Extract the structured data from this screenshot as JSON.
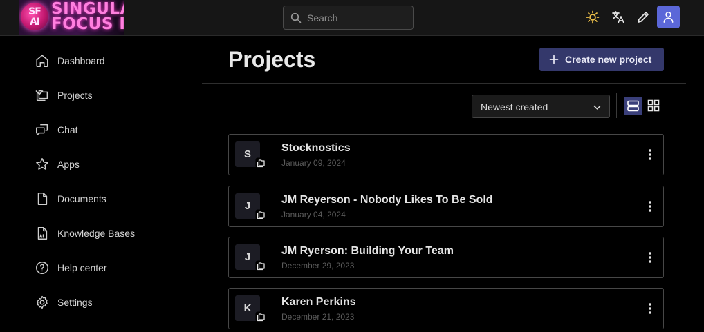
{
  "logo": {
    "badge_line1": "SF",
    "badge_line2": "AI",
    "text_line1": "SINGULAR",
    "text_line2": "FOCUS  I"
  },
  "search": {
    "placeholder": "Search"
  },
  "topbar": {
    "icons": [
      "sun-icon",
      "translate-icon",
      "pencil-icon",
      "user-icon"
    ],
    "accent": "#5b67d8"
  },
  "sidebar": {
    "items": [
      {
        "label": "Dashboard",
        "icon": "home-icon"
      },
      {
        "label": "Projects",
        "icon": "folders-icon",
        "expandable": true
      },
      {
        "label": "Chat",
        "icon": "chat-icon"
      },
      {
        "label": "Apps",
        "icon": "star-icon"
      },
      {
        "label": "Documents",
        "icon": "document-icon"
      },
      {
        "label": "Knowledge Bases",
        "icon": "knowledge-base-icon"
      },
      {
        "label": "Help center",
        "icon": "help-icon"
      },
      {
        "label": "Settings",
        "icon": "gear-icon"
      }
    ]
  },
  "main": {
    "title": "Projects",
    "create_label": "Create new project",
    "sort_value": "Newest created",
    "projects": [
      {
        "initial": "S",
        "name": "Stocknostics",
        "date": "January 09, 2024"
      },
      {
        "initial": "J",
        "name": "JM Reyerson - Nobody Likes To Be Sold",
        "date": "January 04, 2024"
      },
      {
        "initial": "J",
        "name": "JM Ryerson: Building Your Team",
        "date": "December 29, 2023"
      },
      {
        "initial": "K",
        "name": "Karen Perkins",
        "date": "December 21, 2023"
      }
    ]
  }
}
